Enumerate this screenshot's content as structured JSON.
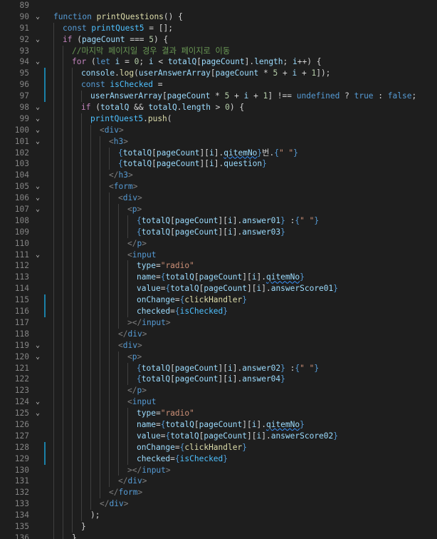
{
  "lines": [
    {
      "num": "89",
      "indent": 0,
      "fold": "",
      "changed": false,
      "tokens": []
    },
    {
      "num": "90",
      "indent": 0,
      "fold": "v",
      "changed": false,
      "tokens": [
        [
          "k",
          "function "
        ],
        [
          "fn",
          "printQuestions"
        ],
        [
          "p",
          "() {"
        ]
      ]
    },
    {
      "num": "91",
      "indent": 1,
      "fold": "",
      "changed": false,
      "tokens": [
        [
          "k",
          "const "
        ],
        [
          "c",
          "printQuest5"
        ],
        [
          "p",
          " = [];"
        ]
      ]
    },
    {
      "num": "92",
      "indent": 1,
      "fold": "v",
      "changed": false,
      "tokens": [
        [
          "kc",
          "if "
        ],
        [
          "p",
          "("
        ],
        [
          "v",
          "pageCount"
        ],
        [
          "p",
          " === "
        ],
        [
          "n",
          "5"
        ],
        [
          "p",
          ") {"
        ]
      ]
    },
    {
      "num": "93",
      "indent": 2,
      "fold": "",
      "changed": false,
      "tokens": [
        [
          "cm",
          "//마지막 페이지일 경우 결과 페이지로 이동"
        ]
      ]
    },
    {
      "num": "94",
      "indent": 2,
      "fold": "v",
      "changed": false,
      "tokens": [
        [
          "kc",
          "for "
        ],
        [
          "p",
          "("
        ],
        [
          "k",
          "let "
        ],
        [
          "v",
          "i"
        ],
        [
          "p",
          " = "
        ],
        [
          "n",
          "0"
        ],
        [
          "p",
          "; "
        ],
        [
          "v",
          "i"
        ],
        [
          "p",
          " < "
        ],
        [
          "v",
          "totalQ"
        ],
        [
          "p",
          "["
        ],
        [
          "v",
          "pageCount"
        ],
        [
          "p",
          "]."
        ],
        [
          "v",
          "length"
        ],
        [
          "p",
          "; "
        ],
        [
          "v",
          "i"
        ],
        [
          "p",
          "++) {"
        ]
      ]
    },
    {
      "num": "95",
      "indent": 3,
      "fold": "",
      "changed": true,
      "tokens": [
        [
          "v",
          "console"
        ],
        [
          "p",
          "."
        ],
        [
          "fn",
          "log"
        ],
        [
          "p",
          "("
        ],
        [
          "v",
          "userAnswerArray"
        ],
        [
          "p",
          "["
        ],
        [
          "v",
          "pageCount"
        ],
        [
          "p",
          " * "
        ],
        [
          "n",
          "5"
        ],
        [
          "p",
          " + "
        ],
        [
          "v",
          "i"
        ],
        [
          "p",
          " + "
        ],
        [
          "n",
          "1"
        ],
        [
          "p",
          "]);"
        ]
      ]
    },
    {
      "num": "96",
      "indent": 3,
      "fold": "",
      "changed": true,
      "tokens": [
        [
          "k",
          "const "
        ],
        [
          "c",
          "isChecked"
        ],
        [
          "p",
          " ="
        ]
      ]
    },
    {
      "num": "97",
      "indent": 4,
      "fold": "",
      "changed": true,
      "tokens": [
        [
          "v",
          "userAnswerArray"
        ],
        [
          "p",
          "["
        ],
        [
          "v",
          "pageCount"
        ],
        [
          "p",
          " * "
        ],
        [
          "n",
          "5"
        ],
        [
          "p",
          " + "
        ],
        [
          "v",
          "i"
        ],
        [
          "p",
          " + "
        ],
        [
          "n",
          "1"
        ],
        [
          "p",
          "] !== "
        ],
        [
          "k",
          "undefined"
        ],
        [
          "p",
          " ? "
        ],
        [
          "k",
          "true"
        ],
        [
          "p",
          " : "
        ],
        [
          "k",
          "false"
        ],
        [
          "p",
          ";"
        ]
      ]
    },
    {
      "num": "98",
      "indent": 3,
      "fold": "v",
      "changed": false,
      "tokens": [
        [
          "kc",
          "if "
        ],
        [
          "p",
          "("
        ],
        [
          "v",
          "totalQ"
        ],
        [
          "p",
          " && "
        ],
        [
          "v",
          "totalQ"
        ],
        [
          "p",
          "."
        ],
        [
          "v",
          "length"
        ],
        [
          "p",
          " > "
        ],
        [
          "n",
          "0"
        ],
        [
          "p",
          ") {"
        ]
      ]
    },
    {
      "num": "99",
      "indent": 4,
      "fold": "v",
      "changed": false,
      "tokens": [
        [
          "c",
          "printQuest5"
        ],
        [
          "p",
          "."
        ],
        [
          "fn",
          "push"
        ],
        [
          "p",
          "("
        ]
      ]
    },
    {
      "num": "100",
      "indent": 5,
      "fold": "v",
      "changed": false,
      "tokens": [
        [
          "t",
          "<"
        ],
        [
          "tg",
          "div"
        ],
        [
          "t",
          ">"
        ]
      ]
    },
    {
      "num": "101",
      "indent": 6,
      "fold": "v",
      "changed": false,
      "tokens": [
        [
          "t",
          "<"
        ],
        [
          "tg",
          "h3"
        ],
        [
          "t",
          ">"
        ]
      ]
    },
    {
      "num": "102",
      "indent": 7,
      "fold": "",
      "changed": false,
      "tokens": [
        [
          "k",
          "{"
        ],
        [
          "v",
          "totalQ"
        ],
        [
          "p",
          "["
        ],
        [
          "v",
          "pageCount"
        ],
        [
          "p",
          "]["
        ],
        [
          "v",
          "i"
        ],
        [
          "p",
          "]."
        ],
        [
          "v",
          "qitemNo",
          "squig"
        ],
        [
          "k",
          "}"
        ],
        [
          "p",
          "번."
        ],
        [
          "k",
          "{"
        ],
        [
          "s",
          "\" \""
        ],
        [
          "k",
          "}"
        ]
      ]
    },
    {
      "num": "103",
      "indent": 7,
      "fold": "",
      "changed": false,
      "tokens": [
        [
          "k",
          "{"
        ],
        [
          "v",
          "totalQ"
        ],
        [
          "p",
          "["
        ],
        [
          "v",
          "pageCount"
        ],
        [
          "p",
          "]["
        ],
        [
          "v",
          "i"
        ],
        [
          "p",
          "]."
        ],
        [
          "v",
          "question"
        ],
        [
          "k",
          "}"
        ]
      ]
    },
    {
      "num": "104",
      "indent": 6,
      "fold": "",
      "changed": false,
      "tokens": [
        [
          "t",
          "</"
        ],
        [
          "tg",
          "h3"
        ],
        [
          "t",
          ">"
        ]
      ]
    },
    {
      "num": "105",
      "indent": 6,
      "fold": "v",
      "changed": false,
      "tokens": [
        [
          "t",
          "<"
        ],
        [
          "tg",
          "form"
        ],
        [
          "t",
          ">"
        ]
      ]
    },
    {
      "num": "106",
      "indent": 7,
      "fold": "v",
      "changed": false,
      "tokens": [
        [
          "t",
          "<"
        ],
        [
          "tg",
          "div"
        ],
        [
          "t",
          ">"
        ]
      ]
    },
    {
      "num": "107",
      "indent": 8,
      "fold": "v",
      "changed": false,
      "tokens": [
        [
          "t",
          "<"
        ],
        [
          "tg",
          "p"
        ],
        [
          "t",
          ">"
        ]
      ]
    },
    {
      "num": "108",
      "indent": 9,
      "fold": "",
      "changed": false,
      "tokens": [
        [
          "k",
          "{"
        ],
        [
          "v",
          "totalQ"
        ],
        [
          "p",
          "["
        ],
        [
          "v",
          "pageCount"
        ],
        [
          "p",
          "]["
        ],
        [
          "v",
          "i"
        ],
        [
          "p",
          "]."
        ],
        [
          "v",
          "answer01"
        ],
        [
          "k",
          "}"
        ],
        [
          "p",
          " :"
        ],
        [
          "k",
          "{"
        ],
        [
          "s",
          "\" \""
        ],
        [
          "k",
          "}"
        ]
      ]
    },
    {
      "num": "109",
      "indent": 9,
      "fold": "",
      "changed": false,
      "tokens": [
        [
          "k",
          "{"
        ],
        [
          "v",
          "totalQ"
        ],
        [
          "p",
          "["
        ],
        [
          "v",
          "pageCount"
        ],
        [
          "p",
          "]["
        ],
        [
          "v",
          "i"
        ],
        [
          "p",
          "]."
        ],
        [
          "v",
          "answer03"
        ],
        [
          "k",
          "}"
        ]
      ]
    },
    {
      "num": "110",
      "indent": 8,
      "fold": "",
      "changed": false,
      "tokens": [
        [
          "t",
          "</"
        ],
        [
          "tg",
          "p"
        ],
        [
          "t",
          ">"
        ]
      ]
    },
    {
      "num": "111",
      "indent": 8,
      "fold": "v",
      "changed": false,
      "tokens": [
        [
          "t",
          "<"
        ],
        [
          "tg",
          "input"
        ]
      ]
    },
    {
      "num": "112",
      "indent": 9,
      "fold": "",
      "changed": false,
      "tokens": [
        [
          "at",
          "type"
        ],
        [
          "p",
          "="
        ],
        [
          "s",
          "\"radio\""
        ]
      ]
    },
    {
      "num": "113",
      "indent": 9,
      "fold": "",
      "changed": false,
      "tokens": [
        [
          "at",
          "name"
        ],
        [
          "p",
          "="
        ],
        [
          "k",
          "{"
        ],
        [
          "v",
          "totalQ"
        ],
        [
          "p",
          "["
        ],
        [
          "v",
          "pageCount"
        ],
        [
          "p",
          "]["
        ],
        [
          "v",
          "i"
        ],
        [
          "p",
          "]."
        ],
        [
          "v",
          "qitemNo",
          "squig"
        ],
        [
          "k",
          "}"
        ]
      ]
    },
    {
      "num": "114",
      "indent": 9,
      "fold": "",
      "changed": false,
      "tokens": [
        [
          "at",
          "value"
        ],
        [
          "p",
          "="
        ],
        [
          "k",
          "{"
        ],
        [
          "v",
          "totalQ"
        ],
        [
          "p",
          "["
        ],
        [
          "v",
          "pageCount"
        ],
        [
          "p",
          "]["
        ],
        [
          "v",
          "i"
        ],
        [
          "p",
          "]."
        ],
        [
          "v",
          "answerScore01"
        ],
        [
          "k",
          "}"
        ]
      ]
    },
    {
      "num": "115",
      "indent": 9,
      "fold": "",
      "changed": true,
      "tokens": [
        [
          "at",
          "onChange"
        ],
        [
          "p",
          "="
        ],
        [
          "k",
          "{"
        ],
        [
          "fn",
          "clickHandler"
        ],
        [
          "k",
          "}"
        ]
      ]
    },
    {
      "num": "116",
      "indent": 9,
      "fold": "",
      "changed": true,
      "tokens": [
        [
          "at",
          "checked"
        ],
        [
          "p",
          "="
        ],
        [
          "k",
          "{"
        ],
        [
          "c",
          "isChecked"
        ],
        [
          "k",
          "}"
        ]
      ]
    },
    {
      "num": "117",
      "indent": 8,
      "fold": "",
      "changed": false,
      "tokens": [
        [
          "t",
          "></"
        ],
        [
          "tg",
          "input"
        ],
        [
          "t",
          ">"
        ]
      ]
    },
    {
      "num": "118",
      "indent": 7,
      "fold": "",
      "changed": false,
      "tokens": [
        [
          "t",
          "</"
        ],
        [
          "tg",
          "div"
        ],
        [
          "t",
          ">"
        ]
      ]
    },
    {
      "num": "119",
      "indent": 7,
      "fold": "v",
      "changed": false,
      "tokens": [
        [
          "t",
          "<"
        ],
        [
          "tg",
          "div"
        ],
        [
          "t",
          ">"
        ]
      ]
    },
    {
      "num": "120",
      "indent": 8,
      "fold": "v",
      "changed": false,
      "tokens": [
        [
          "t",
          "<"
        ],
        [
          "tg",
          "p"
        ],
        [
          "t",
          ">"
        ]
      ]
    },
    {
      "num": "121",
      "indent": 9,
      "fold": "",
      "changed": false,
      "tokens": [
        [
          "k",
          "{"
        ],
        [
          "v",
          "totalQ"
        ],
        [
          "p",
          "["
        ],
        [
          "v",
          "pageCount"
        ],
        [
          "p",
          "]["
        ],
        [
          "v",
          "i"
        ],
        [
          "p",
          "]."
        ],
        [
          "v",
          "answer02"
        ],
        [
          "k",
          "}"
        ],
        [
          "p",
          " :"
        ],
        [
          "k",
          "{"
        ],
        [
          "s",
          "\" \""
        ],
        [
          "k",
          "}"
        ]
      ]
    },
    {
      "num": "122",
      "indent": 9,
      "fold": "",
      "changed": false,
      "tokens": [
        [
          "k",
          "{"
        ],
        [
          "v",
          "totalQ"
        ],
        [
          "p",
          "["
        ],
        [
          "v",
          "pageCount"
        ],
        [
          "p",
          "]["
        ],
        [
          "v",
          "i"
        ],
        [
          "p",
          "]."
        ],
        [
          "v",
          "answer04"
        ],
        [
          "k",
          "}"
        ]
      ]
    },
    {
      "num": "123",
      "indent": 8,
      "fold": "",
      "changed": false,
      "tokens": [
        [
          "t",
          "</"
        ],
        [
          "tg",
          "p"
        ],
        [
          "t",
          ">"
        ]
      ]
    },
    {
      "num": "124",
      "indent": 8,
      "fold": "v",
      "changed": false,
      "tokens": [
        [
          "t",
          "<"
        ],
        [
          "tg",
          "input"
        ]
      ]
    },
    {
      "num": "125",
      "indent": 9,
      "fold": "v",
      "changed": false,
      "tokens": [
        [
          "at",
          "type"
        ],
        [
          "p",
          "="
        ],
        [
          "s",
          "\"radio\""
        ]
      ]
    },
    {
      "num": "126",
      "indent": 9,
      "fold": "",
      "changed": false,
      "tokens": [
        [
          "at",
          "name"
        ],
        [
          "p",
          "="
        ],
        [
          "k",
          "{"
        ],
        [
          "v",
          "totalQ"
        ],
        [
          "p",
          "["
        ],
        [
          "v",
          "pageCount"
        ],
        [
          "p",
          "]["
        ],
        [
          "v",
          "i"
        ],
        [
          "p",
          "]."
        ],
        [
          "v",
          "qitemNo",
          "squig"
        ],
        [
          "k",
          "}"
        ]
      ]
    },
    {
      "num": "127",
      "indent": 9,
      "fold": "",
      "changed": false,
      "tokens": [
        [
          "at",
          "value"
        ],
        [
          "p",
          "="
        ],
        [
          "k",
          "{"
        ],
        [
          "v",
          "totalQ"
        ],
        [
          "p",
          "["
        ],
        [
          "v",
          "pageCount"
        ],
        [
          "p",
          "]["
        ],
        [
          "v",
          "i"
        ],
        [
          "p",
          "]."
        ],
        [
          "v",
          "answerScore02"
        ],
        [
          "k",
          "}"
        ]
      ]
    },
    {
      "num": "128",
      "indent": 9,
      "fold": "",
      "changed": true,
      "tokens": [
        [
          "at",
          "onChange"
        ],
        [
          "p",
          "="
        ],
        [
          "k",
          "{"
        ],
        [
          "fn",
          "clickHandler"
        ],
        [
          "k",
          "}"
        ]
      ]
    },
    {
      "num": "129",
      "indent": 9,
      "fold": "",
      "changed": true,
      "tokens": [
        [
          "at",
          "checked"
        ],
        [
          "p",
          "="
        ],
        [
          "k",
          "{"
        ],
        [
          "c",
          "isChecked"
        ],
        [
          "k",
          "}"
        ]
      ]
    },
    {
      "num": "130",
      "indent": 8,
      "fold": "",
      "changed": false,
      "tokens": [
        [
          "t",
          "></"
        ],
        [
          "tg",
          "input"
        ],
        [
          "t",
          ">"
        ]
      ]
    },
    {
      "num": "131",
      "indent": 7,
      "fold": "",
      "changed": false,
      "tokens": [
        [
          "t",
          "</"
        ],
        [
          "tg",
          "div"
        ],
        [
          "t",
          ">"
        ]
      ]
    },
    {
      "num": "132",
      "indent": 6,
      "fold": "",
      "changed": false,
      "tokens": [
        [
          "t",
          "</"
        ],
        [
          "tg",
          "form"
        ],
        [
          "t",
          ">"
        ]
      ]
    },
    {
      "num": "133",
      "indent": 5,
      "fold": "",
      "changed": false,
      "tokens": [
        [
          "t",
          "</"
        ],
        [
          "tg",
          "div"
        ],
        [
          "t",
          ">"
        ]
      ]
    },
    {
      "num": "134",
      "indent": 4,
      "fold": "",
      "changed": false,
      "tokens": [
        [
          "p",
          ");"
        ]
      ]
    },
    {
      "num": "135",
      "indent": 3,
      "fold": "",
      "changed": false,
      "tokens": [
        [
          "p",
          "}"
        ]
      ]
    },
    {
      "num": "136",
      "indent": 2,
      "fold": "",
      "changed": false,
      "tokens": [
        [
          "p",
          "}"
        ]
      ]
    }
  ]
}
